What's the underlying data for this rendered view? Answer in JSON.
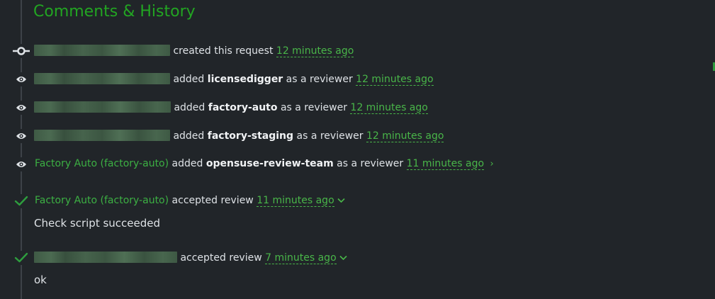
{
  "section": {
    "title": "Comments & History"
  },
  "events": [
    {
      "verb": "created this request",
      "time": "12 minutes ago"
    },
    {
      "verb_pre": "added",
      "target": "licensedigger",
      "verb_post": "as a reviewer",
      "time": "12 minutes ago"
    },
    {
      "verb_pre": "added",
      "target": "factory-auto",
      "verb_post": "as a reviewer",
      "time": "12 minutes ago"
    },
    {
      "verb_pre": "added",
      "target": "factory-staging",
      "verb_post": "as a reviewer",
      "time": "12 minutes ago"
    },
    {
      "user": "Factory Auto (factory-auto)",
      "verb_pre": "added",
      "target": "opensuse-review-team",
      "verb_post": "as a reviewer",
      "time": "11 minutes ago"
    },
    {
      "user": "Factory Auto (factory-auto)",
      "verb": "accepted review",
      "time": "11 minutes ago",
      "comment": "Check script succeeded"
    },
    {
      "verb": "accepted review",
      "time": "7 minutes ago",
      "comment": "ok"
    }
  ],
  "colors": {
    "accent": "#22a522",
    "link": "#49b649",
    "background": "#212529"
  },
  "icons": [
    "commit-icon",
    "eye-icon",
    "check-icon",
    "chevron-right-icon",
    "chevron-down-icon"
  ]
}
